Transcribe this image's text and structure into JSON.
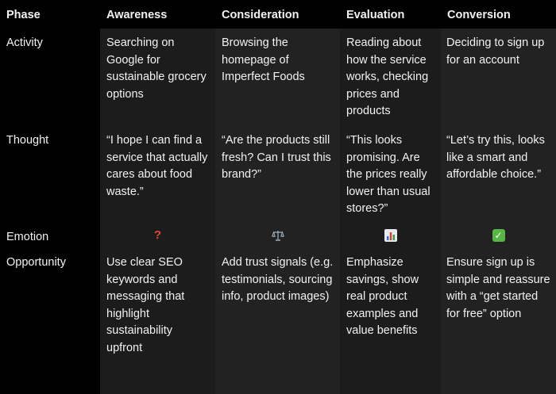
{
  "header": {
    "phase": "Phase",
    "stages": [
      "Awareness",
      "Consideration",
      "Evaluation",
      "Conversion"
    ]
  },
  "rows": [
    {
      "label": "Activity",
      "cells": [
        "Searching on Google for sustainable grocery options",
        "Browsing the homepage of Imperfect Foods",
        "Reading about how the service works, checking prices and products",
        "Deciding to sign up for an account"
      ]
    },
    {
      "label": "Thought",
      "cells": [
        "“I hope I can find a service that actually cares about food waste.”",
        "“Are the products still fresh? Can I trust this brand?”",
        "“This looks promising. Are the prices really lower than usual stores?”",
        "“Let’s try this, looks like a smart and affordable choice.”"
      ]
    },
    {
      "label": "Emotion",
      "icons": [
        "question-mark-icon",
        "balance-scale-icon",
        "bar-chart-icon",
        "check-mark-icon"
      ]
    },
    {
      "label": "Opportunity",
      "cells": [
        "Use clear SEO keywords and messaging that highlight sustainability upfront",
        "Add trust signals (e.g. testimonials, sourcing info, product images)",
        "Emphasize savings, show real product examples and value benefits",
        "Ensure sign up is simple and reassure with a “get started for free” option"
      ]
    }
  ],
  "colors": {
    "page_background": "#000000",
    "column_dark": "#1c1c1c",
    "column_light": "#222222",
    "text": "#f2f2f2",
    "question_icon": "#e0483a",
    "check_icon": "#58b646"
  }
}
